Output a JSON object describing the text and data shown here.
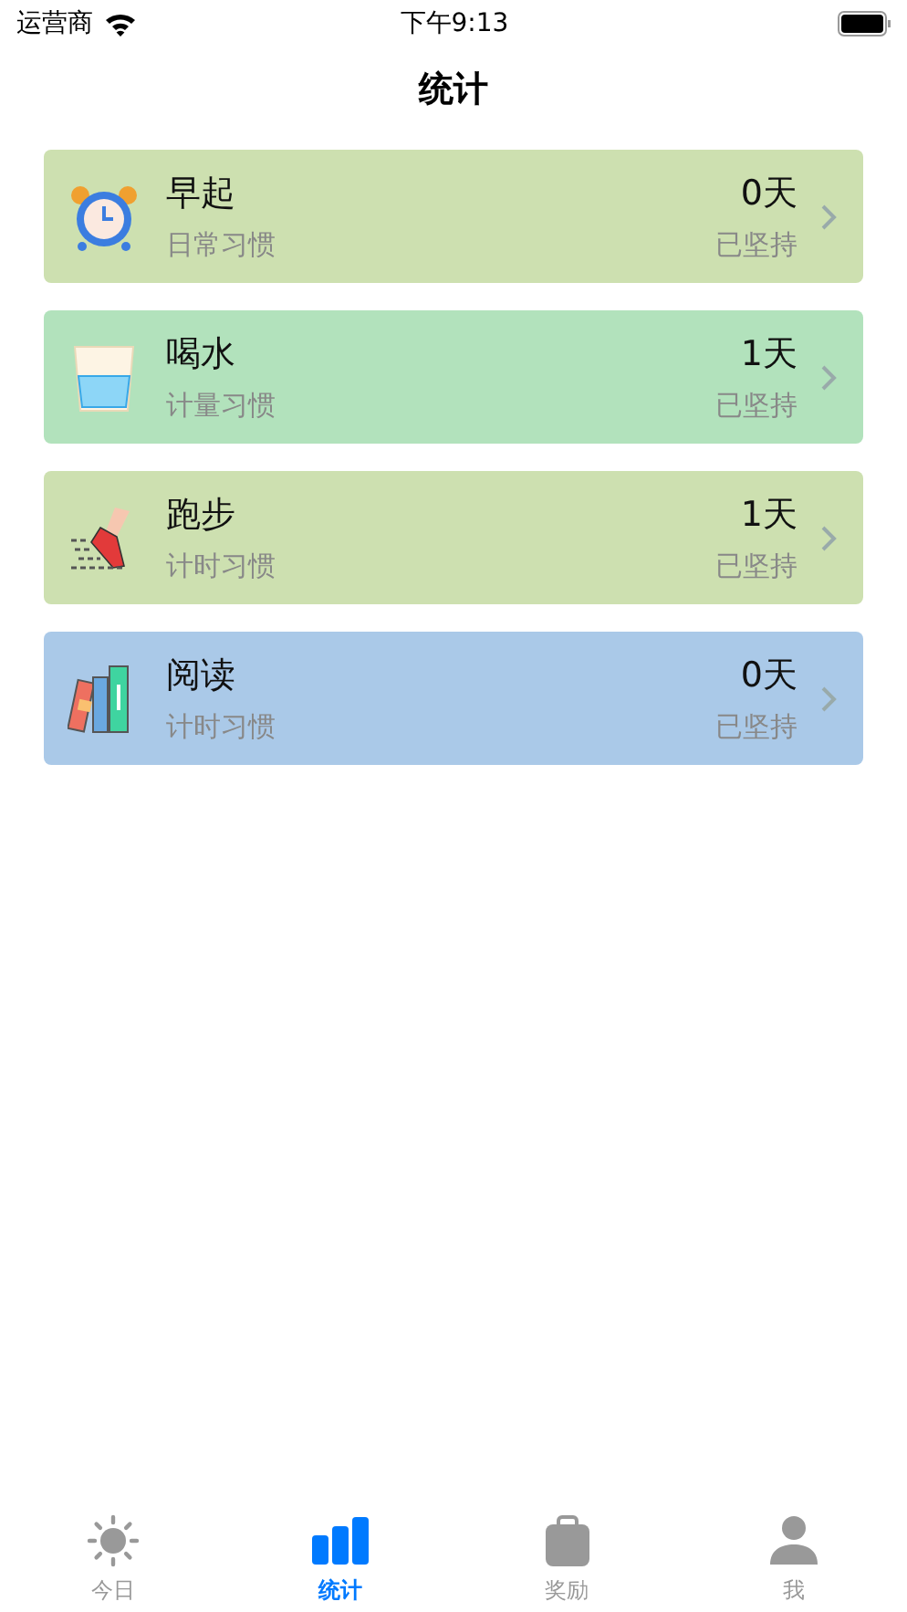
{
  "status_bar": {
    "carrier": "运营商",
    "time": "下午9:13"
  },
  "title": "统计",
  "habits": [
    {
      "kind": "alarm",
      "name": "早起",
      "type": "日常习惯",
      "days": "0天",
      "caption": "已坚持",
      "color": "#cde0b0"
    },
    {
      "kind": "glass",
      "name": "喝水",
      "type": "计量习惯",
      "days": "1天",
      "caption": "已坚持",
      "color": "#b2e2bc"
    },
    {
      "kind": "shoe",
      "name": "跑步",
      "type": "计时习惯",
      "days": "1天",
      "caption": "已坚持",
      "color": "#cde0b0"
    },
    {
      "kind": "books",
      "name": "阅读",
      "type": "计时习惯",
      "days": "0天",
      "caption": "已坚持",
      "color": "#aac9e8"
    }
  ],
  "tabs": [
    {
      "kind": "sun",
      "label": "今日",
      "selected": false
    },
    {
      "kind": "bars",
      "label": "统计",
      "selected": true
    },
    {
      "kind": "bag",
      "label": "奖励",
      "selected": false
    },
    {
      "kind": "person",
      "label": "我",
      "selected": false
    }
  ]
}
